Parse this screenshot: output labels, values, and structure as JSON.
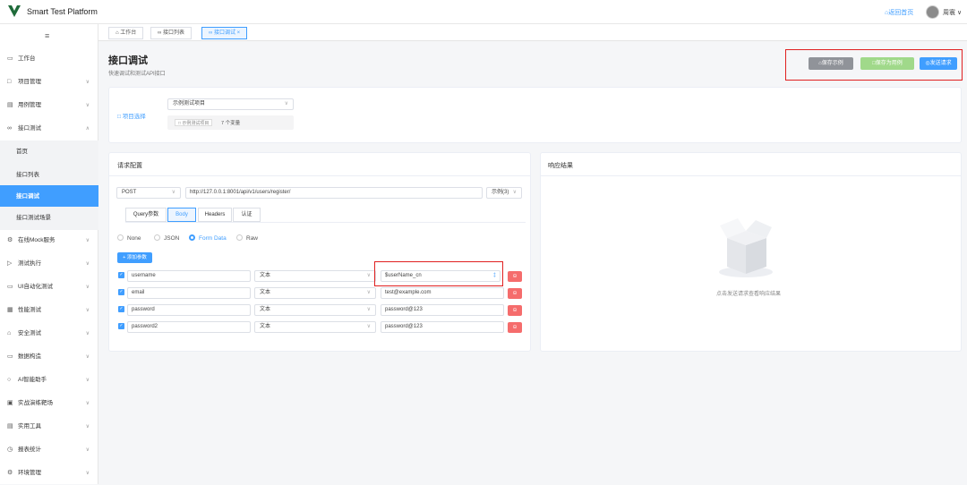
{
  "app": {
    "title": "Smart Test Platform",
    "back_home": "返回首页",
    "user": "周寰"
  },
  "sidebar": {
    "toggle_icon": "≡",
    "items": [
      {
        "label": "工作台",
        "icon": "monitor-icon"
      },
      {
        "label": "项目管理",
        "icon": "folder-icon"
      },
      {
        "label": "用例管理",
        "icon": "document-icon"
      },
      {
        "label": "接口测试",
        "icon": "link-icon"
      },
      {
        "label": "首页"
      },
      {
        "label": "接口列表"
      },
      {
        "label": "接口调试"
      },
      {
        "label": "接口测试场景"
      },
      {
        "label": "在线Mock服务",
        "icon": "mock-icon"
      },
      {
        "label": "测试执行",
        "icon": "play-icon"
      },
      {
        "label": "UI自动化测试",
        "icon": "screen-icon"
      },
      {
        "label": "性能测试",
        "icon": "chart-icon"
      },
      {
        "label": "安全测试",
        "icon": "lock-icon"
      },
      {
        "label": "数据构造",
        "icon": "data-icon"
      },
      {
        "label": "AI智能助手",
        "icon": "chat-icon"
      },
      {
        "label": "实战演练靶场",
        "icon": "target-icon"
      },
      {
        "label": "实用工具",
        "icon": "tool-icon"
      },
      {
        "label": "报表统计",
        "icon": "clock-icon"
      },
      {
        "label": "环境管理",
        "icon": "gear-icon"
      }
    ]
  },
  "tabs": [
    {
      "label": "工作台",
      "icon": "home-icon"
    },
    {
      "label": "接口列表",
      "icon": "link-icon"
    },
    {
      "label": "接口调试",
      "icon": "link-icon"
    }
  ],
  "page": {
    "title": "接口调试",
    "subtitle": "快速调试和测试API接口"
  },
  "actions": {
    "save_example": "保存示例",
    "save_as_case": "保存为用例",
    "send_request": "发送请求"
  },
  "project": {
    "label": "项目选择",
    "selected": "示例测试项目",
    "tag": "示例测试项目",
    "var_count": "7 个变量"
  },
  "request": {
    "title": "请求配置",
    "method": "POST",
    "url": "http://127.0.0.1:8001/api/v1/users/register/",
    "example": "示例(3)",
    "subtabs": [
      "Query参数",
      "Body",
      "Headers",
      "认证"
    ],
    "body_types": [
      "None",
      "JSON",
      "Form Data",
      "Raw"
    ],
    "add_param": "+ 添加参数",
    "params": [
      {
        "key": "username",
        "type": "文本",
        "value": "$userName_cn"
      },
      {
        "key": "email",
        "type": "文本",
        "value": "test@example.com"
      },
      {
        "key": "password",
        "type": "文本",
        "value": "password@123"
      },
      {
        "key": "password2",
        "type": "文本",
        "value": "password@123"
      }
    ]
  },
  "response": {
    "title": "响应结果",
    "empty_text": "点击发送请求查看响应结果"
  },
  "colors": {
    "primary": "#409eff",
    "danger": "#f56c6c",
    "info": "#909399",
    "success_light": "#a0d98a"
  }
}
